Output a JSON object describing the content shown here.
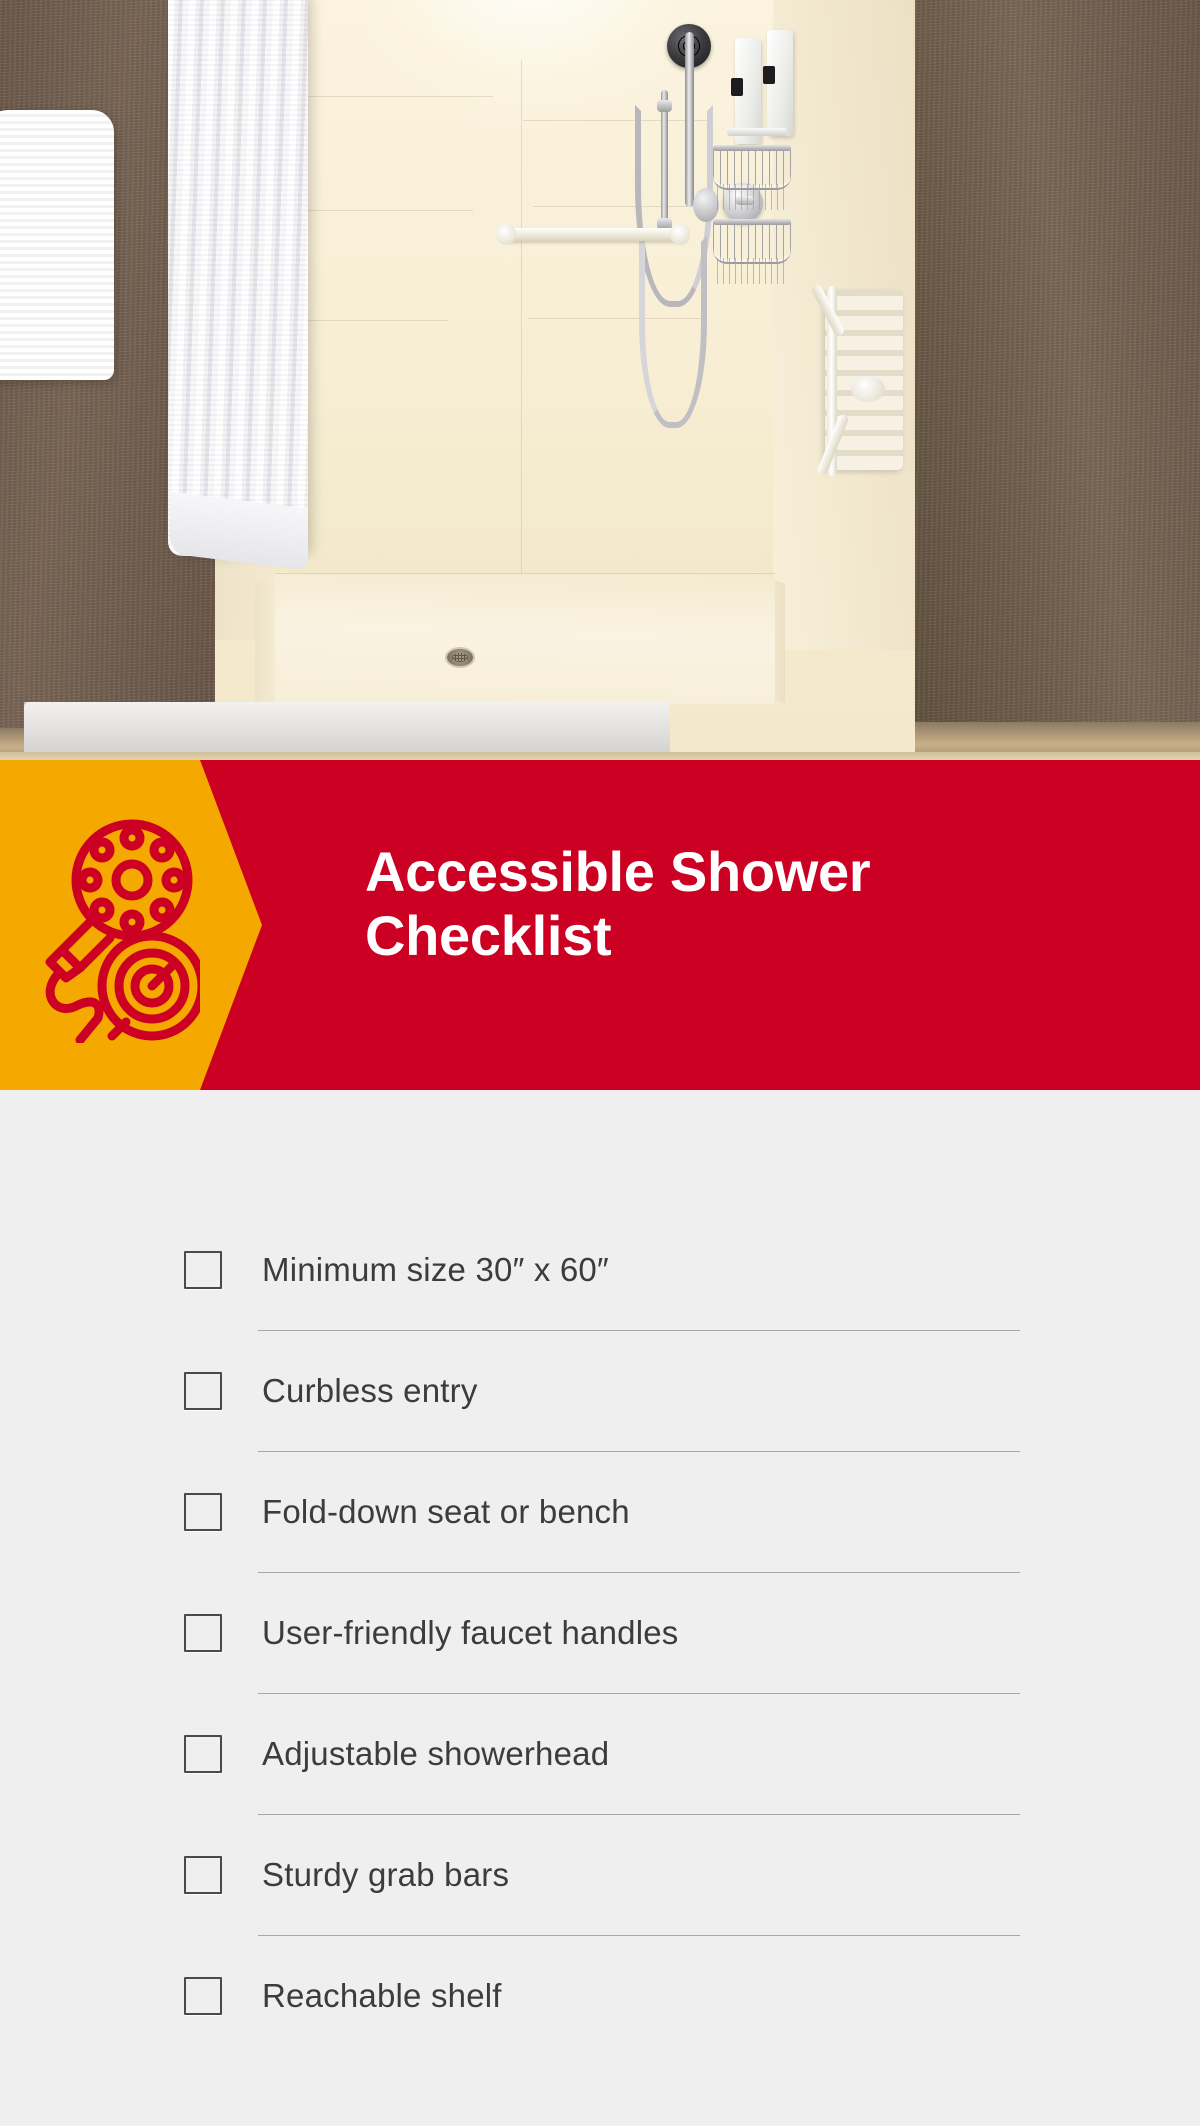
{
  "photo": {
    "alt": "Accessible roll-in shower with beige fiberglass surround, white shower curtain, horizontal grab bar, handheld adjustable showerhead on slide bar, wire corner baskets, wall-mounted soap dispensers, fold-down shower seat and marble threshold",
    "elements": [
      "shower-curtain",
      "folded-towel",
      "handheld-showerhead",
      "slide-bar",
      "shower-hose",
      "grab-bar",
      "mixing-valve",
      "wire-basket",
      "soap-dispenser",
      "fold-down-seat",
      "shower-pan-drain",
      "marble-threshold"
    ]
  },
  "banner": {
    "title_line_1": "Accessible Shower",
    "title_line_2": "Checklist",
    "icon_name": "handheld-showerhead-icon",
    "colors": {
      "background": "#cc0022",
      "accent_panel": "#f5a800",
      "icon_stroke": "#cc0022",
      "title_text": "#ffffff"
    }
  },
  "checklist": {
    "background": "#efefef",
    "text_color": "#3c3c3c",
    "checkbox_border": "#4a4a4a",
    "divider_color": "#9a9a9a",
    "items": [
      {
        "label": "Minimum size 30″ x 60″",
        "checked": false
      },
      {
        "label": "Curbless entry",
        "checked": false
      },
      {
        "label": "Fold-down seat or bench",
        "checked": false
      },
      {
        "label": "User-friendly faucet handles",
        "checked": false
      },
      {
        "label": "Adjustable showerhead",
        "checked": false
      },
      {
        "label": "Sturdy grab bars",
        "checked": false
      },
      {
        "label": "Reachable shelf",
        "checked": false
      }
    ]
  }
}
